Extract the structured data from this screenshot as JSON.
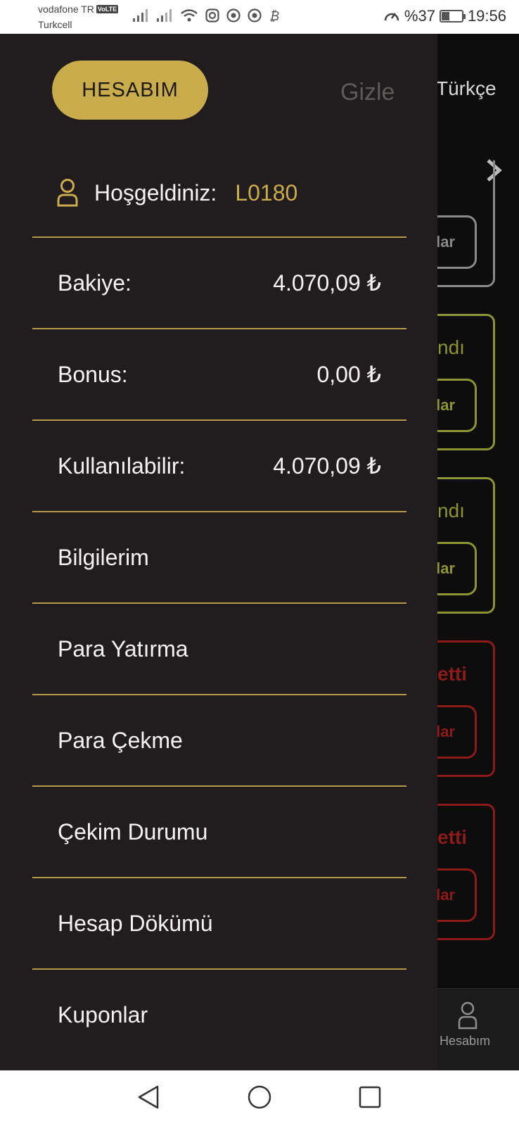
{
  "status_bar": {
    "carrier_primary": "vodafone TR",
    "volte": "VoLTE",
    "carrier_secondary": "Turkcell",
    "battery_text": "%37",
    "battery_level": 0.37,
    "time": "19:56"
  },
  "drawer": {
    "account_button": "HESABIM",
    "hide_link": "Gizle",
    "welcome_label": "Hoşgeldiniz:",
    "username": "L0180",
    "balances": [
      {
        "label": "Bakiye:",
        "value": "4.070,09 ₺"
      },
      {
        "label": "Bonus:",
        "value": "0,00 ₺"
      },
      {
        "label": "Kullanılabilir:",
        "value": "4.070,09 ₺"
      }
    ],
    "menu": [
      {
        "label": "Bilgilerim"
      },
      {
        "label": "Para Yatırma"
      },
      {
        "label": "Para Çekme"
      },
      {
        "label": "Çekim Durumu"
      },
      {
        "label": "Hesap Dökümü"
      },
      {
        "label": "Kuponlar"
      }
    ]
  },
  "background_app": {
    "language": "Türkçe",
    "fragments": [
      "lar",
      "ndı",
      "lar",
      "ndı",
      "lar",
      "etti",
      "lar",
      "etti",
      "lar"
    ],
    "bottom_nav_label": "Hesabım"
  },
  "colors": {
    "accent_gold": "#c9ac4c",
    "drawer_bg": "#211d1e",
    "divider": "#b7974a",
    "won_green": "#9aa33a",
    "lost_red": "#9d1c1c"
  }
}
